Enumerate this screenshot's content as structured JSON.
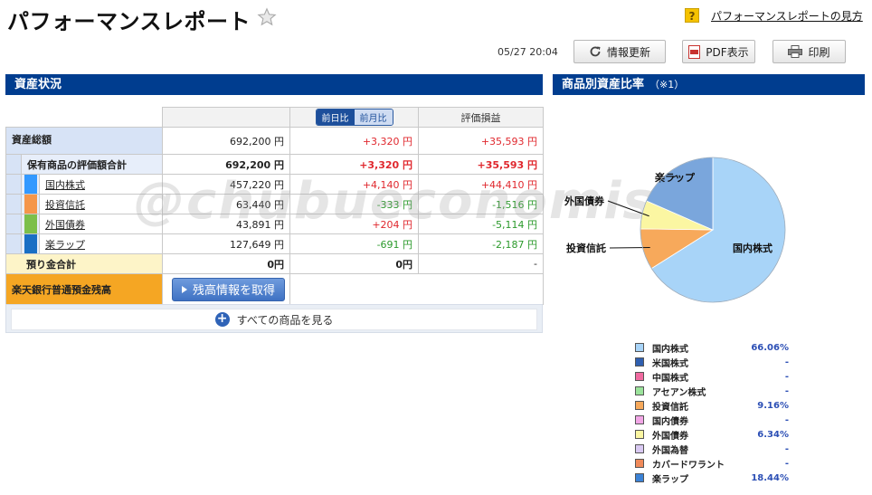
{
  "header": {
    "title": "パフォーマンスレポート",
    "help_icon": "?",
    "help_link": "パフォーマンスレポートの見方"
  },
  "toolbar": {
    "timestamp": "05/27 20:04",
    "refresh_label": "情報更新",
    "pdf_label": "PDF表示",
    "print_label": "印刷"
  },
  "left_section": {
    "title": "資産状況"
  },
  "right_section": {
    "title": "商品別資産比率",
    "note": "（※1）"
  },
  "table": {
    "toggle_day": "前日比",
    "toggle_month": "前月比",
    "col_gain": "評価損益",
    "total": {
      "label": "資産総額",
      "value": "692,200 円",
      "change": "+3,320 円",
      "gain": "+35,593 円"
    },
    "holdings": {
      "label": "保有商品の評価額合計",
      "value": "692,200 円",
      "change": "+3,320 円",
      "gain": "+35,593 円"
    },
    "rows": [
      {
        "label": "国内株式",
        "color": "#3399ff",
        "value": "457,220 円",
        "change": "+4,140 円",
        "gain": "+44,410 円"
      },
      {
        "label": "投資信託",
        "color": "#f5964a",
        "value": "63,440 円",
        "change": "-333 円",
        "gain": "-1,516 円"
      },
      {
        "label": "外国債券",
        "color": "#7cbf4a",
        "value": "43,891 円",
        "change": "+204 円",
        "gain": "-5,114 円"
      },
      {
        "label": "楽ラップ",
        "color": "#1a6fc4",
        "value": "127,649 円",
        "change": "-691 円",
        "gain": "-2,187 円"
      }
    ],
    "deposit": {
      "label": "預り金合計",
      "value": "0円",
      "change": "0円",
      "gain": "-"
    },
    "bank": {
      "label": "楽天銀行普通預金残高",
      "button": "残高情報を取得"
    }
  },
  "view_all": "すべての商品を見る",
  "watermark": "@chubueconomist",
  "chart_data": {
    "type": "pie",
    "slices": [
      {
        "label": "国内株式",
        "value": 66.06,
        "color": "#a8d4f8"
      },
      {
        "label": "投資信託",
        "value": 9.16,
        "color": "#f7a95b"
      },
      {
        "label": "外国債券",
        "value": 6.34,
        "color": "#fbf6a2"
      },
      {
        "label": "楽ラップ",
        "value": 18.44,
        "color": "#7aa6dc"
      }
    ]
  },
  "legend": [
    {
      "label": "国内株式",
      "value": "66.06%",
      "color": "#a8d4f8"
    },
    {
      "label": "米国株式",
      "value": "-",
      "color": "#2f5fb0"
    },
    {
      "label": "中国株式",
      "value": "-",
      "color": "#f06aa0"
    },
    {
      "label": "アセアン株式",
      "value": "-",
      "color": "#9be39b"
    },
    {
      "label": "投資信託",
      "value": "9.16%",
      "color": "#f7a95b"
    },
    {
      "label": "国内債券",
      "value": "-",
      "color": "#f2a6e6"
    },
    {
      "label": "外国債券",
      "value": "6.34%",
      "color": "#fbf6a2"
    },
    {
      "label": "外国為替",
      "value": "-",
      "color": "#d9c9f2"
    },
    {
      "label": "カバードワラント",
      "value": "-",
      "color": "#f08a5a"
    },
    {
      "label": "楽ラップ",
      "value": "18.44%",
      "color": "#3b82d6"
    }
  ]
}
